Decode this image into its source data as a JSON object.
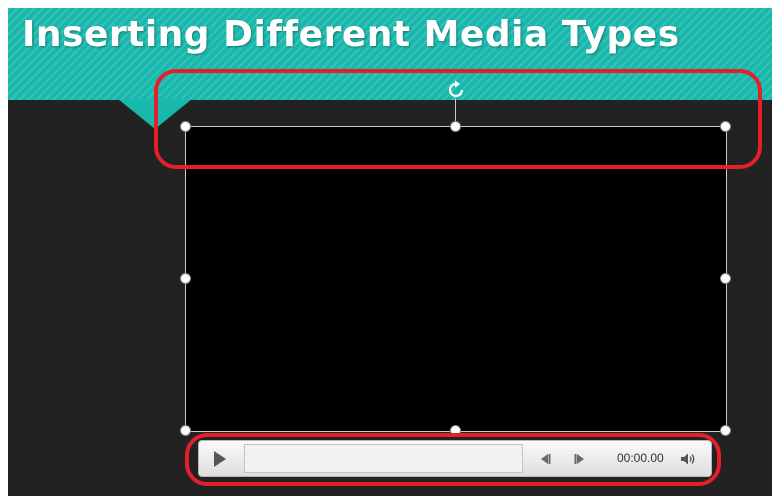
{
  "slide": {
    "title": "Inserting Different Media Types",
    "colors": {
      "banner": "#19b8ac",
      "background": "#222222",
      "callout": "#e2202c"
    }
  },
  "video": {
    "selected": true,
    "icons": [
      "rotate-handle-icon",
      "sizing-handle-icon"
    ]
  },
  "player": {
    "time": "00:00.00",
    "progress": 0,
    "icons": [
      "play-icon",
      "step-back-icon",
      "step-forward-icon",
      "volume-icon"
    ]
  }
}
